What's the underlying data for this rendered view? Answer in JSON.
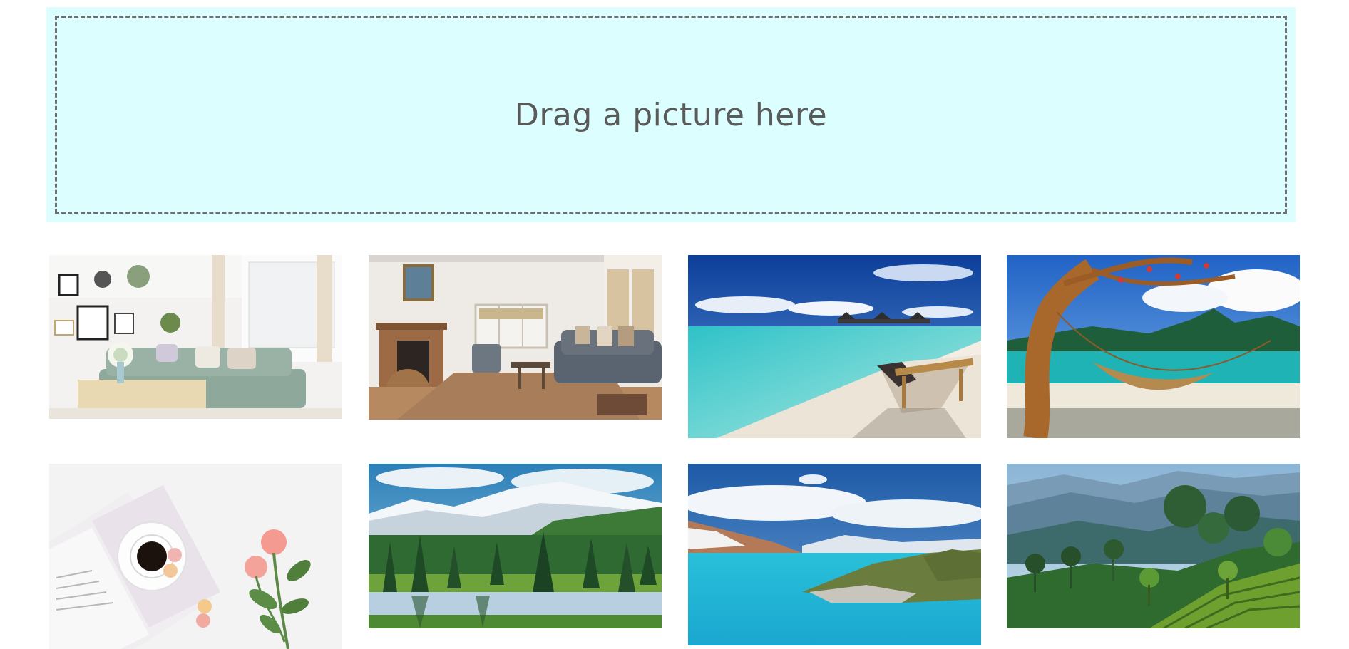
{
  "dropzone": {
    "label": "Drag a picture here"
  },
  "gallery": {
    "images": [
      {
        "subject": "white-living-room"
      },
      {
        "subject": "living-room-with-fireplace"
      },
      {
        "subject": "beach-with-lounge-chair"
      },
      {
        "subject": "hammock-on-tropical-beach"
      },
      {
        "subject": "coffee-cup-with-roses"
      },
      {
        "subject": "mountain-forest-lake"
      },
      {
        "subject": "turquoise-lake-with-mountains"
      },
      {
        "subject": "tea-plantation-hills"
      }
    ]
  }
}
